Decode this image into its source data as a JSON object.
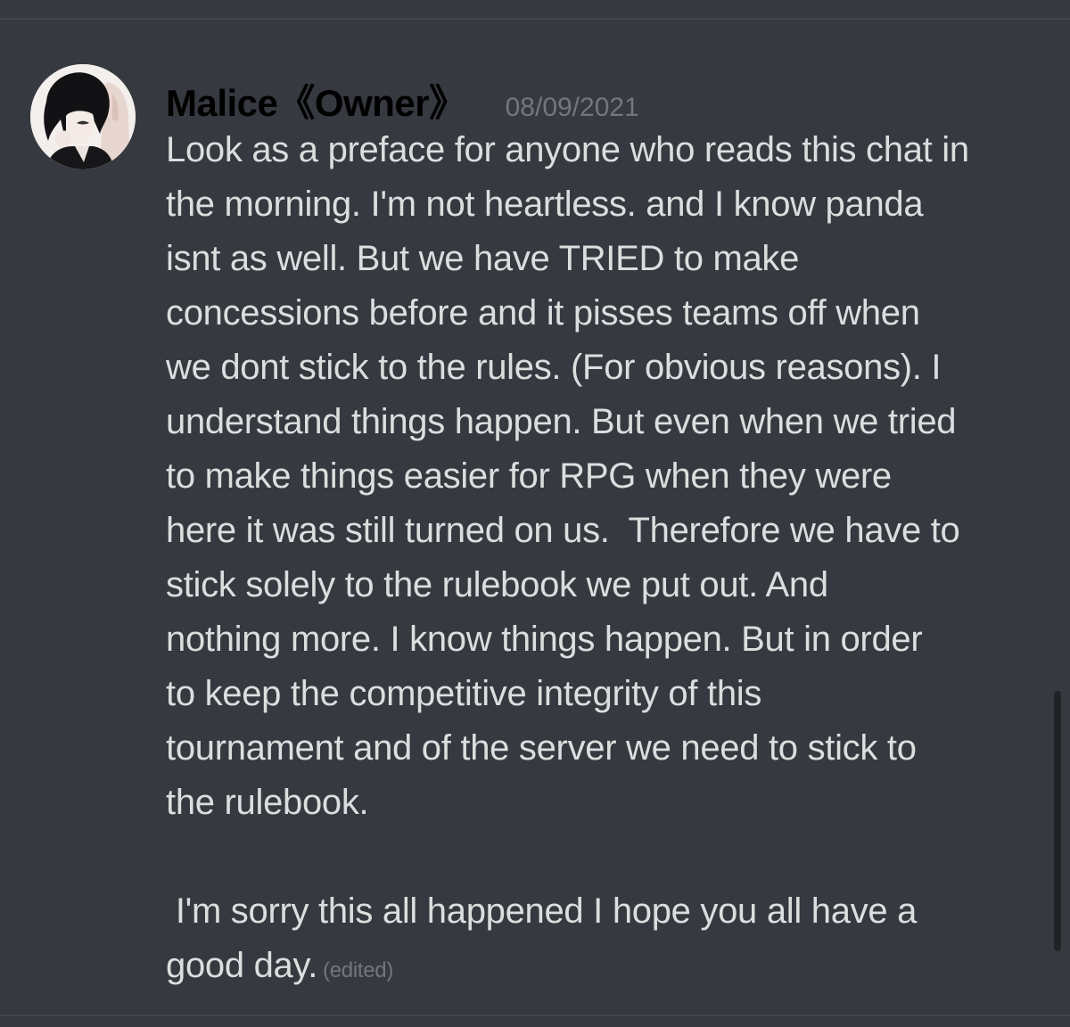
{
  "message": {
    "author": "Malice《Owner》",
    "timestamp": "08/09/2021",
    "text": "Look as a preface for anyone who reads this chat in\nthe morning. I'm not heartless. and I know panda\nisnt as well. But we have TRIED to make\nconcessions before and it pisses teams off when\nwe dont stick to the rules. (For obvious reasons). I\nunderstand things happen. But even when we tried\nto make things easier for RPG when they were\nhere it was still turned on us.  Therefore we have to\nstick solely to the rulebook we put out. And\nnothing more. I know things happen. But in order\nto keep the competitive integrity of this\ntournament and of the server we need to stick to\nthe rulebook.\n\n I'm sorry this all happened I hope you all have a\ngood day.",
    "edited_label": "(edited)"
  },
  "colors": {
    "background": "#36393f",
    "author": "#000000",
    "body_text": "#dcddde",
    "muted": "#72767d",
    "scrollbar": "#202225"
  },
  "icons": {
    "avatar": "anime-avatar",
    "scrollbar": "scrollbar-thumb"
  }
}
